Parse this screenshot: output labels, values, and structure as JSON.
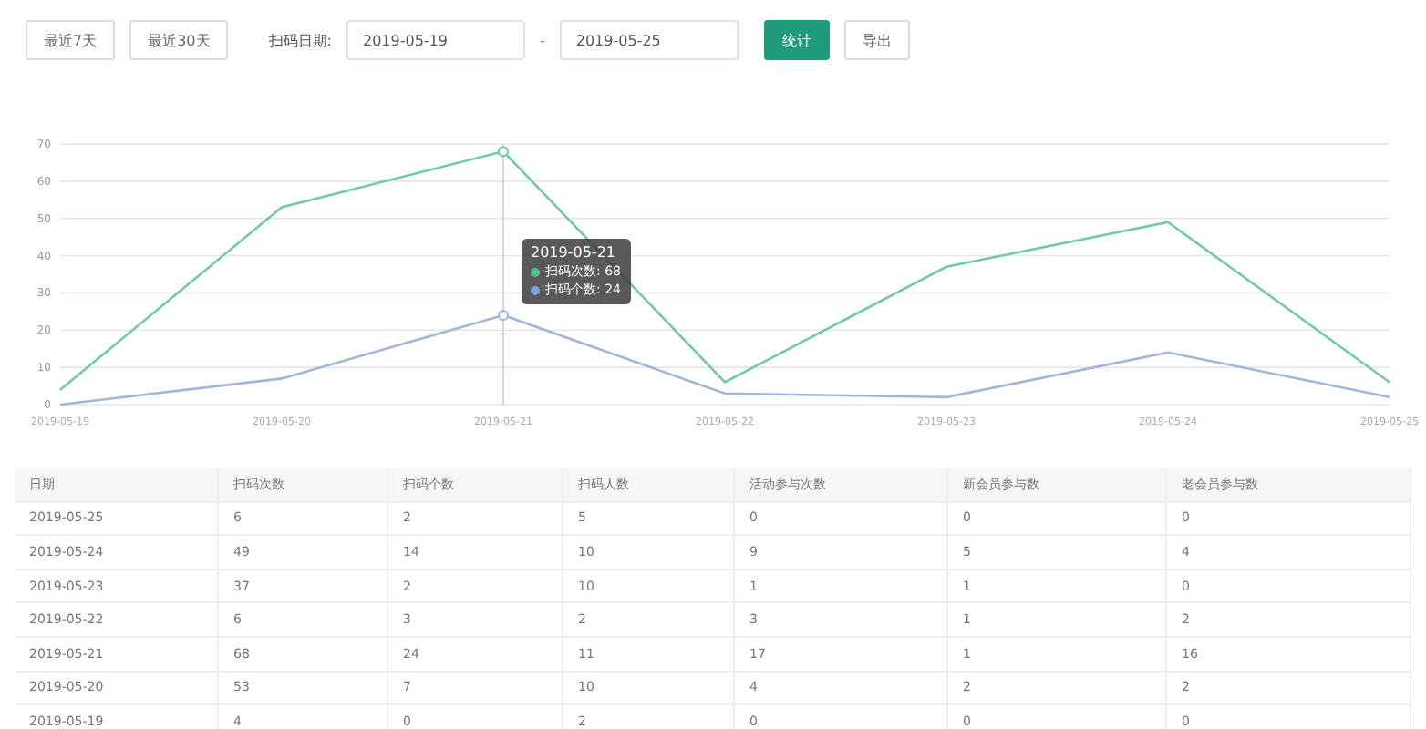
{
  "toolbar": {
    "quick_ranges": [
      {
        "label": "最近7天",
        "selected": false
      },
      {
        "label": "最近30天",
        "selected": false
      }
    ],
    "date_label": "扫码日期:",
    "start_date": "2019-05-19",
    "separator": "-",
    "end_date": "2019-05-25",
    "buttons": [
      {
        "label": "统计",
        "kind": "primary"
      },
      {
        "label": "导出",
        "kind": "default"
      }
    ]
  },
  "chart": {
    "chart_data": {
      "type": "line",
      "categories": [
        "2019-05-19",
        "2019-05-20",
        "2019-05-21",
        "2019-05-22",
        "2019-05-23",
        "2019-05-24",
        "2019-05-25"
      ],
      "ylim": [
        0,
        70
      ],
      "grid": true,
      "ref_lines": [
        {
          "axis": "x",
          "value": "2019-05-21"
        }
      ],
      "yticks": [
        0,
        10,
        20,
        30,
        40,
        50,
        60,
        70
      ],
      "series": [
        {
          "name": "扫码次数",
          "color": "#6fcaa6",
          "values": [
            4,
            53,
            68,
            6,
            37,
            49,
            6
          ]
        },
        {
          "name": "扫码个数",
          "color": "#a3b5dc",
          "values": [
            0,
            7,
            24,
            3,
            2,
            14,
            2
          ]
        }
      ]
    },
    "tooltip": {
      "title": "2019-05-21",
      "delimiter": ": ",
      "items": [
        {
          "value": "68",
          "color": "#4cc38a"
        },
        {
          "value": "24",
          "color": "#7aa3d9"
        }
      ]
    }
  },
  "table": {
    "columns": [
      "日期",
      "扫码次数",
      "扫码个数",
      "扫码人数",
      "活动参与次数",
      "新会员参与数",
      "老会员参与数"
    ],
    "rows": [
      [
        "2019-05-25",
        "6",
        "2",
        "5",
        "0",
        "0",
        "0"
      ],
      [
        "2019-05-24",
        "49",
        "14",
        "10",
        "9",
        "5",
        "4"
      ],
      [
        "2019-05-23",
        "37",
        "2",
        "10",
        "1",
        "1",
        "0"
      ],
      [
        "2019-05-22",
        "6",
        "3",
        "2",
        "3",
        "1",
        "2"
      ],
      [
        "2019-05-21",
        "68",
        "24",
        "11",
        "17",
        "1",
        "16"
      ],
      [
        "2019-05-20",
        "53",
        "7",
        "10",
        "4",
        "2",
        "2"
      ],
      [
        "2019-05-19",
        "4",
        "0",
        "2",
        "0",
        "0",
        "0"
      ]
    ]
  }
}
